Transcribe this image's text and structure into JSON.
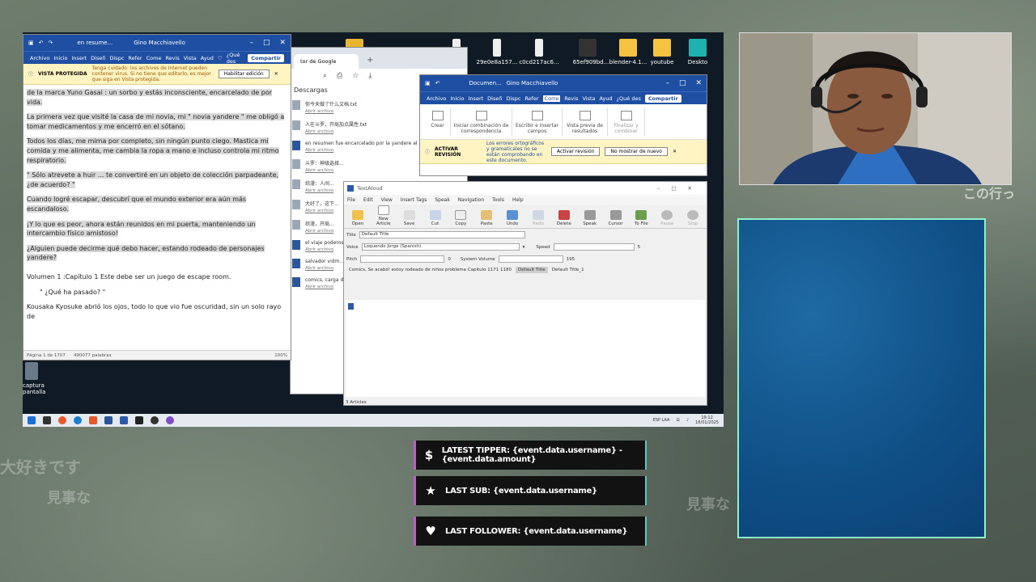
{
  "background": {
    "overlay_text": [
      "大好きです",
      "見事な",
      "見事な",
      "この行っ"
    ]
  },
  "word_window": {
    "title": "en resume...",
    "user": "Gino Macchiavello",
    "ribbon_tabs": [
      "Archivo",
      "Inicio",
      "Insert",
      "Diseñ",
      "Dispc",
      "Refer",
      "Come",
      "Revis",
      "Vista",
      "Ayud"
    ],
    "tell_me": "¿Qué des",
    "share_label": "Compartir",
    "protected_title": "VISTA PROTEGIDA",
    "protected_msg": "Tenga cuidado: los archivos de Internet pueden contener virus. Si no tiene que editarlo, es mejor que siga en Vista protegida.",
    "enable_button": "Habilitar edición",
    "paragraphs": [
      "de la marca Yuno Gasai : un sorbo y estás inconsciente, encarcelado de por vida.",
      "La primera vez que visité la casa de mi novia, mi \" novia yandere \" me obligó a tomar medicamentos y me encerró en el sótano.",
      "Todos los días, me mima por completo, sin ningún punto ciego. Mastica mi comida y me alimenta, me cambia la ropa a mano e incluso controla mi ritmo respiratorio.",
      "\" Sólo atrevete a huir ... te convertiré en un objeto de colección parpadeante, ¿de acuerdo? \"",
      "Cuando logré escapar, descubrí que el mundo exterior era aún más escandaloso.",
      "¡Y lo que es peor, ahora están reunidos en mi puerta, manteniendo un intercambio físico amistoso!",
      "¿Alguien puede decirme qué debo hacer, estando rodeado de personajes yandere?",
      "Volumen 1 :Capítulo 1 Este debe ser un juego de escape room.",
      "\" ¿Qué ha pasado? \"",
      "Kousaka Kyosuke abrió los ojos, todo lo que vio fue oscuridad, sin un solo rayo de"
    ],
    "status": "Página 1 de 1707",
    "word_count": "490077 palabras",
    "zoom": "100%"
  },
  "chrome_window": {
    "tab_title": "tor de Google",
    "section": "Descargas",
    "downloads": [
      {
        "name": "你今天做了什么文档.txt",
        "link": "Abrir archivo"
      },
      {
        "name": "人在斗罗，开局加点属性.txt",
        "link": "Abrir archivo"
      },
      {
        "name": "en resumen fue encarcelado por la yandere al principio.docx",
        "link": "Abrir archivo"
      },
      {
        "name": "斗罗：神级选择...",
        "link": "Abrir archivo"
      },
      {
        "name": "综漫：人间...",
        "link": "Abrir archivo"
      },
      {
        "name": "大好了，这下...",
        "link": "Abrir archivo"
      },
      {
        "name": "综漫，开局...",
        "link": "Abrir archivo"
      },
      {
        "name": "el viaje poderoso...",
        "link": "Abrir archivo"
      },
      {
        "name": "salvador vidm...",
        "link": "Abrir archivo"
      },
      {
        "name": "comics, carga de hermanas.docx",
        "link": "Abrir archivo"
      }
    ]
  },
  "word_window2": {
    "title": "Documen...",
    "user": "Gino Macchiavello",
    "ribbon_tabs": [
      "Archivo",
      "Inicio",
      "Insert",
      "Diseñ",
      "Dispc",
      "Refer",
      "Corre",
      "Revis",
      "Vista",
      "Ayud"
    ],
    "tell_me": "¿Qué des",
    "share_label": "Compartir",
    "groups": [
      "Crear",
      "Iniciar combinación de correspondencia",
      "Escribir e insertar campos",
      "Vista previa de resultados",
      "Finalizar y combinar",
      "Finalizar"
    ],
    "review_title": "ACTIVAR REVISIÓN",
    "review_msg": "Los errores ortográficos y gramaticales no se están comprobando en este documento.",
    "activate_btn": "Activar revisión",
    "dismiss_btn": "No mostrar de nuevo"
  },
  "textaloud": {
    "title": "TextAloud",
    "menu": [
      "File",
      "Edit",
      "View",
      "Insert Tags",
      "Speak",
      "Navigation",
      "Tools",
      "Help"
    ],
    "tools": [
      "Open",
      "New Article",
      "Save",
      "Cut",
      "Copy",
      "Paste",
      "Undo",
      "Redo",
      "Delete",
      "Speak",
      "Cursor",
      "To File",
      "Pause",
      "Stop"
    ],
    "title_label": "Title",
    "title_value": "Default Title",
    "voice_label": "Voice",
    "voice_value": "Loquendo Jorge (Spanish)",
    "speed_label": "Speed",
    "speed_value": "5",
    "pitch_label": "Pitch",
    "pitch_value": "0",
    "volume_label": "System Volume",
    "volume_value": "195",
    "tabs": [
      "Comics, Se acabó! estoy rodeado de niños problema Capitulo 1171 1180",
      "Default Title",
      "Default Title_1"
    ],
    "status": "3 Articles"
  },
  "desktop": {
    "icons": [
      "",
      "",
      "29e0e8a157...",
      "c0cd217ac6...",
      "",
      "65ef909bd...",
      "blender-4.1...",
      "youtube",
      "Deskto"
    ],
    "left_icon": "captura pantalla",
    "clock_time": "19:12",
    "clock_date": "16/01/2025",
    "lang": "ESP LAA"
  },
  "alerts": {
    "tipper": "LATEST TIPPER: {event.data.username} - {event.data.amount}",
    "sub": "LAST SUB: {event.data.username}",
    "follower": "LAST FOLLOWER: {event.data.username}"
  }
}
